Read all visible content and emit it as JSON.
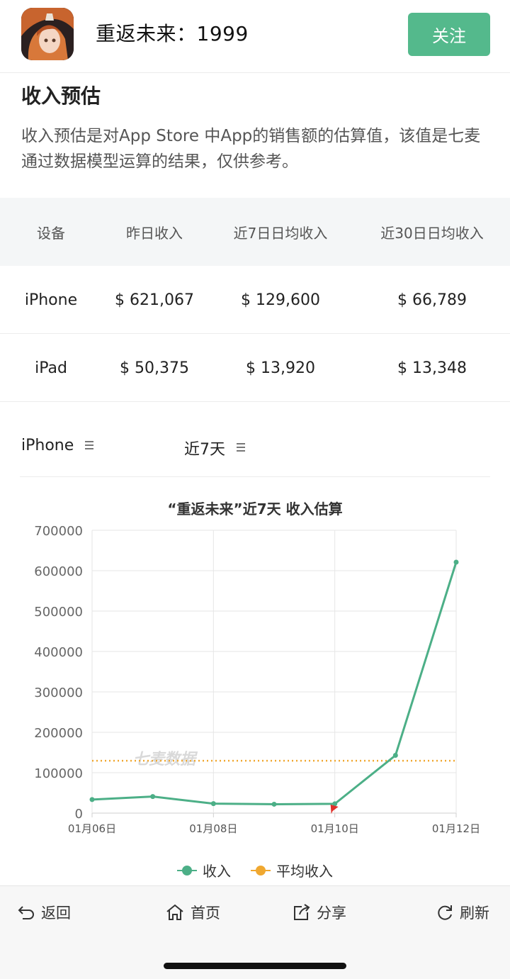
{
  "header": {
    "app_name": "重返未来：1999",
    "follow_label": "关注"
  },
  "section": {
    "title": "收入预估",
    "description": "收入预估是对App Store 中App的销售额的估算值，该值是七麦通过数据模型运算的结果，仅供参考。"
  },
  "table": {
    "headers": [
      "设备",
      "昨日收入",
      "近7日日均收入",
      "近30日日均收入"
    ],
    "rows": [
      [
        "iPhone",
        "$ 621,067",
        "$ 129,600",
        "$ 66,789"
      ],
      [
        "iPad",
        "$ 50,375",
        "$ 13,920",
        "$ 13,348"
      ]
    ]
  },
  "filters": {
    "device": "iPhone",
    "period": "近7天"
  },
  "chart_data": {
    "type": "line",
    "title": "“重返未来”近7天 收入估算",
    "x": [
      "01月06日",
      "01月07日",
      "01月08日",
      "01月09日",
      "01月10日",
      "01月11日",
      "01月12日"
    ],
    "x_tick_labels": [
      "01月06日",
      "01月08日",
      "01月10日",
      "01月12日"
    ],
    "y_ticks": [
      "0",
      "100000",
      "200000",
      "300000",
      "400000",
      "500000",
      "600000",
      "700000"
    ],
    "ylim": [
      0,
      700000
    ],
    "series": [
      {
        "name": "收入",
        "values": [
          33500,
          41000,
          23500,
          22000,
          23000,
          143000,
          621067
        ],
        "color": "#4caf87"
      },
      {
        "name": "平均收入",
        "values": [
          129600,
          129600,
          129600,
          129600,
          129600,
          129600,
          129600
        ],
        "color": "#f0a830"
      }
    ],
    "watermark": "七麦数据",
    "grid": true,
    "legend_position": "bottom"
  },
  "bottom_nav": {
    "back": "返回",
    "home": "首页",
    "share": "分享",
    "refresh": "刷新"
  }
}
